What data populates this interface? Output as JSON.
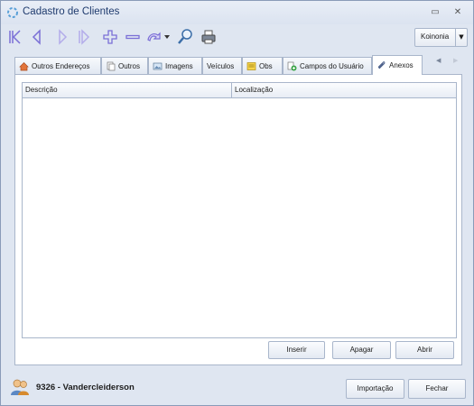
{
  "window": {
    "title": "Cadastro de Clientes"
  },
  "toolbar": {
    "icons": [
      "first-icon",
      "previous-icon",
      "next-icon",
      "last-icon",
      "add-icon",
      "remove-icon",
      "undo-icon",
      "search-icon",
      "print-icon"
    ],
    "company": "Koinonia"
  },
  "tabs": [
    {
      "label": "Outros Endereços",
      "icon": "house-icon"
    },
    {
      "label": "Outros",
      "icon": "documents-icon"
    },
    {
      "label": "Imagens",
      "icon": "image-icon"
    },
    {
      "label": "Veículos",
      "icon": ""
    },
    {
      "label": "Obs",
      "icon": "note-icon"
    },
    {
      "label": "Campos do Usuário",
      "icon": "user-fields-icon"
    },
    {
      "label": "Anexos",
      "icon": "paperclip-icon",
      "active": true
    }
  ],
  "grid": {
    "columns": [
      "Descrição",
      "Localização"
    ],
    "rows": []
  },
  "panel_buttons": {
    "insert": "Inserir",
    "delete": "Apagar",
    "open": "Abrir"
  },
  "footer": {
    "client": "9326 - Vandercleiderson",
    "import": "Importação",
    "close": "Fechar"
  },
  "colors": {
    "accent": "#1f3b6e",
    "border": "#a9b6cb",
    "window_bg": "#dfe6f1",
    "icon_purple": "#7a6fd6"
  }
}
